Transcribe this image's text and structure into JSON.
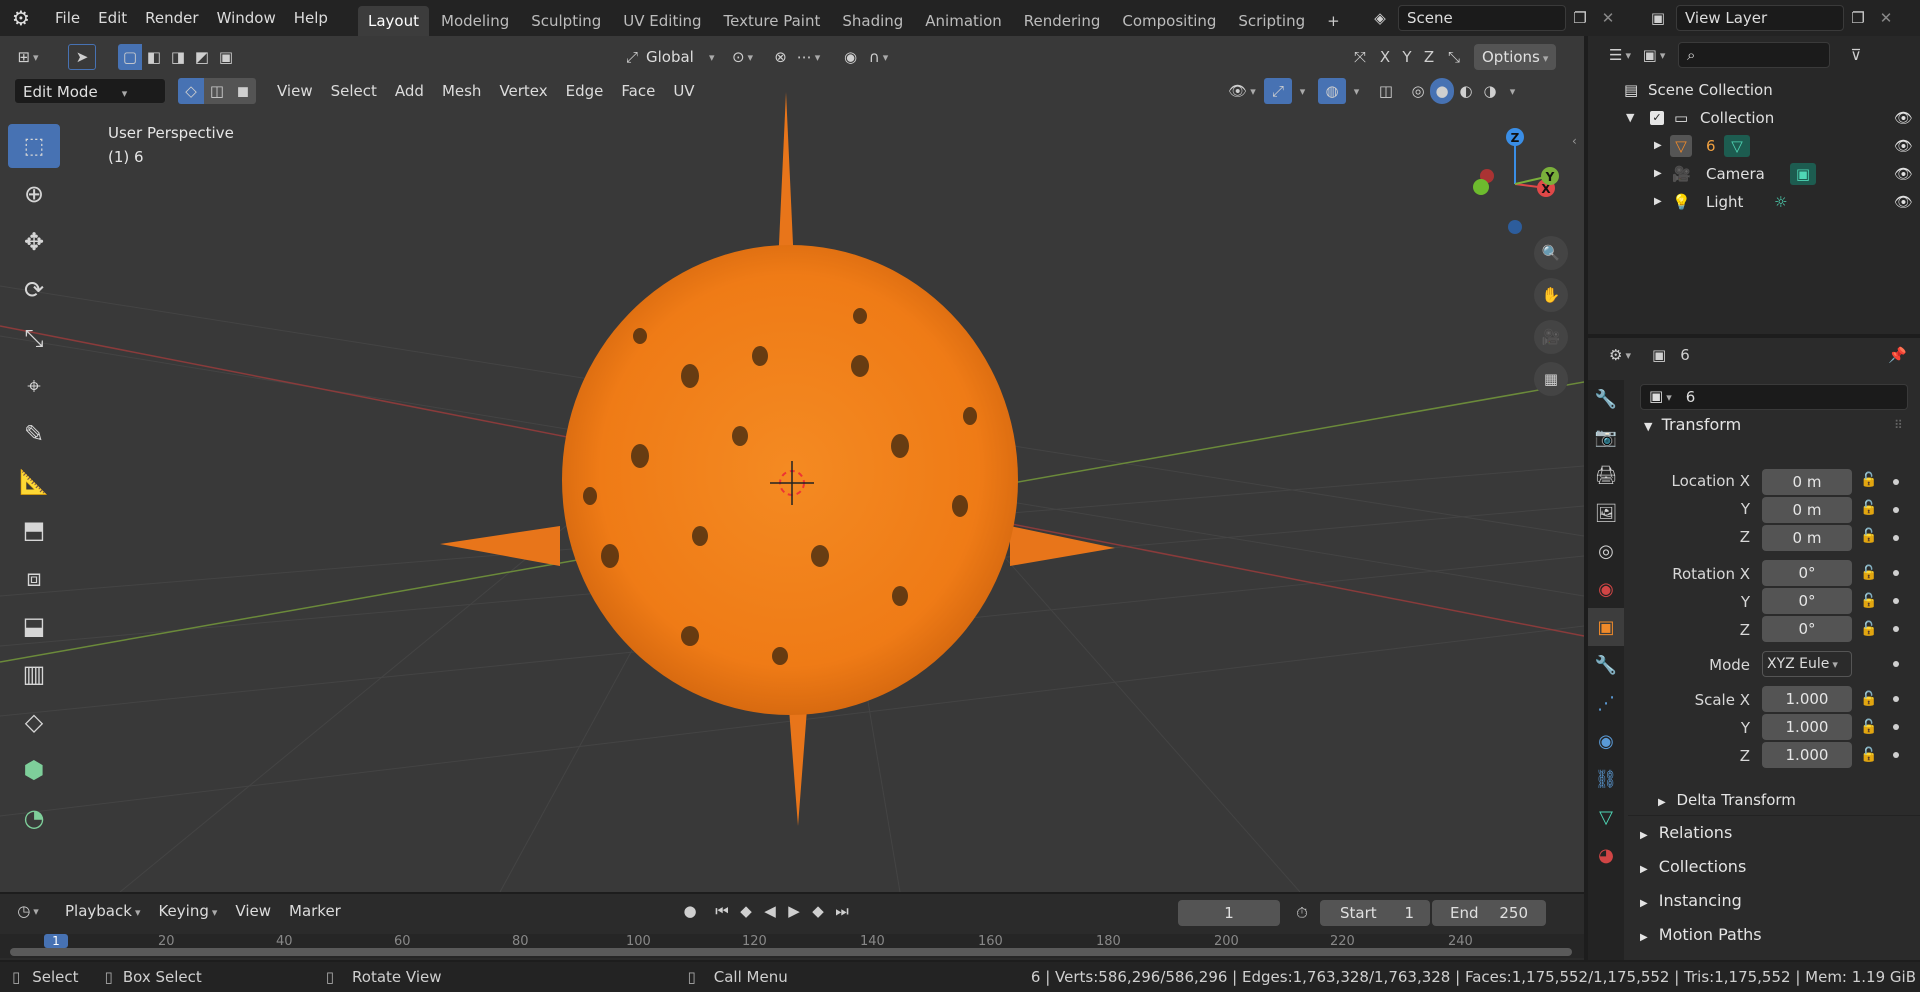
{
  "topbar": {
    "menus": [
      "File",
      "Edit",
      "Render",
      "Window",
      "Help"
    ],
    "workspaces": [
      "Layout",
      "Modeling",
      "Sculpting",
      "UV Editing",
      "Texture Paint",
      "Shading",
      "Animation",
      "Rendering",
      "Compositing",
      "Scripting"
    ],
    "active_workspace": "Layout",
    "scene": "Scene",
    "view_layer": "View Layer"
  },
  "viewport": {
    "transform_orientation": "Global",
    "options_label": "Options",
    "mode": "Edit Mode",
    "menus": [
      "View",
      "Select",
      "Add",
      "Mesh",
      "Vertex",
      "Edge",
      "Face",
      "UV"
    ],
    "overlay_title": "User Perspective",
    "overlay_object": "(1) 6",
    "axis_labels": {
      "x": "X",
      "y": "Y",
      "z": "Z"
    },
    "mesh_color": "#f07f1a",
    "tools": [
      "select-box-icon",
      "cursor-icon",
      "move-icon",
      "rotate-icon",
      "scale-icon",
      "transform-icon",
      "annotate-icon",
      "measure-icon",
      "extrude-icon",
      "inset-icon",
      "bevel-icon",
      "loop-cut-icon",
      "knife-icon",
      "poly-build-icon",
      "spin-icon"
    ]
  },
  "timeline": {
    "menus": [
      "Playback",
      "Keying",
      "View",
      "Marker"
    ],
    "current_frame": "1",
    "start_label": "Start",
    "start": "1",
    "end_label": "End",
    "end": "250",
    "ruler": [
      "1",
      "20",
      "40",
      "60",
      "80",
      "100",
      "120",
      "140",
      "160",
      "180",
      "200",
      "220",
      "240"
    ]
  },
  "outliner": {
    "root": "Scene Collection",
    "collection": "Collection",
    "items": [
      "6",
      "Camera",
      "Light"
    ]
  },
  "properties": {
    "object_name": "6",
    "transform_label": "Transform",
    "location_label": "Location X",
    "rotation_label": "Rotation X",
    "scale_label": "Scale X",
    "y_label": "Y",
    "z_label": "Z",
    "mode_label": "Mode",
    "location": [
      "0 m",
      "0 m",
      "0 m"
    ],
    "rotation": [
      "0°",
      "0°",
      "0°"
    ],
    "mode": "XYZ Eule",
    "scale": [
      "1.000",
      "1.000",
      "1.000"
    ],
    "delta_transform": "Delta Transform",
    "panels": [
      "Relations",
      "Collections",
      "Instancing",
      "Motion Paths"
    ]
  },
  "statusbar": {
    "select": "Select",
    "box_select": "Box Select",
    "rotate_view": "Rotate View",
    "call_menu": "Call Menu",
    "stats": "6 | Verts:586,296/586,296 | Edges:1,763,328/1,763,328 | Faces:1,175,552/1,175,552 | Tris:1,175,552 | Mem: 1.19 GiB"
  }
}
